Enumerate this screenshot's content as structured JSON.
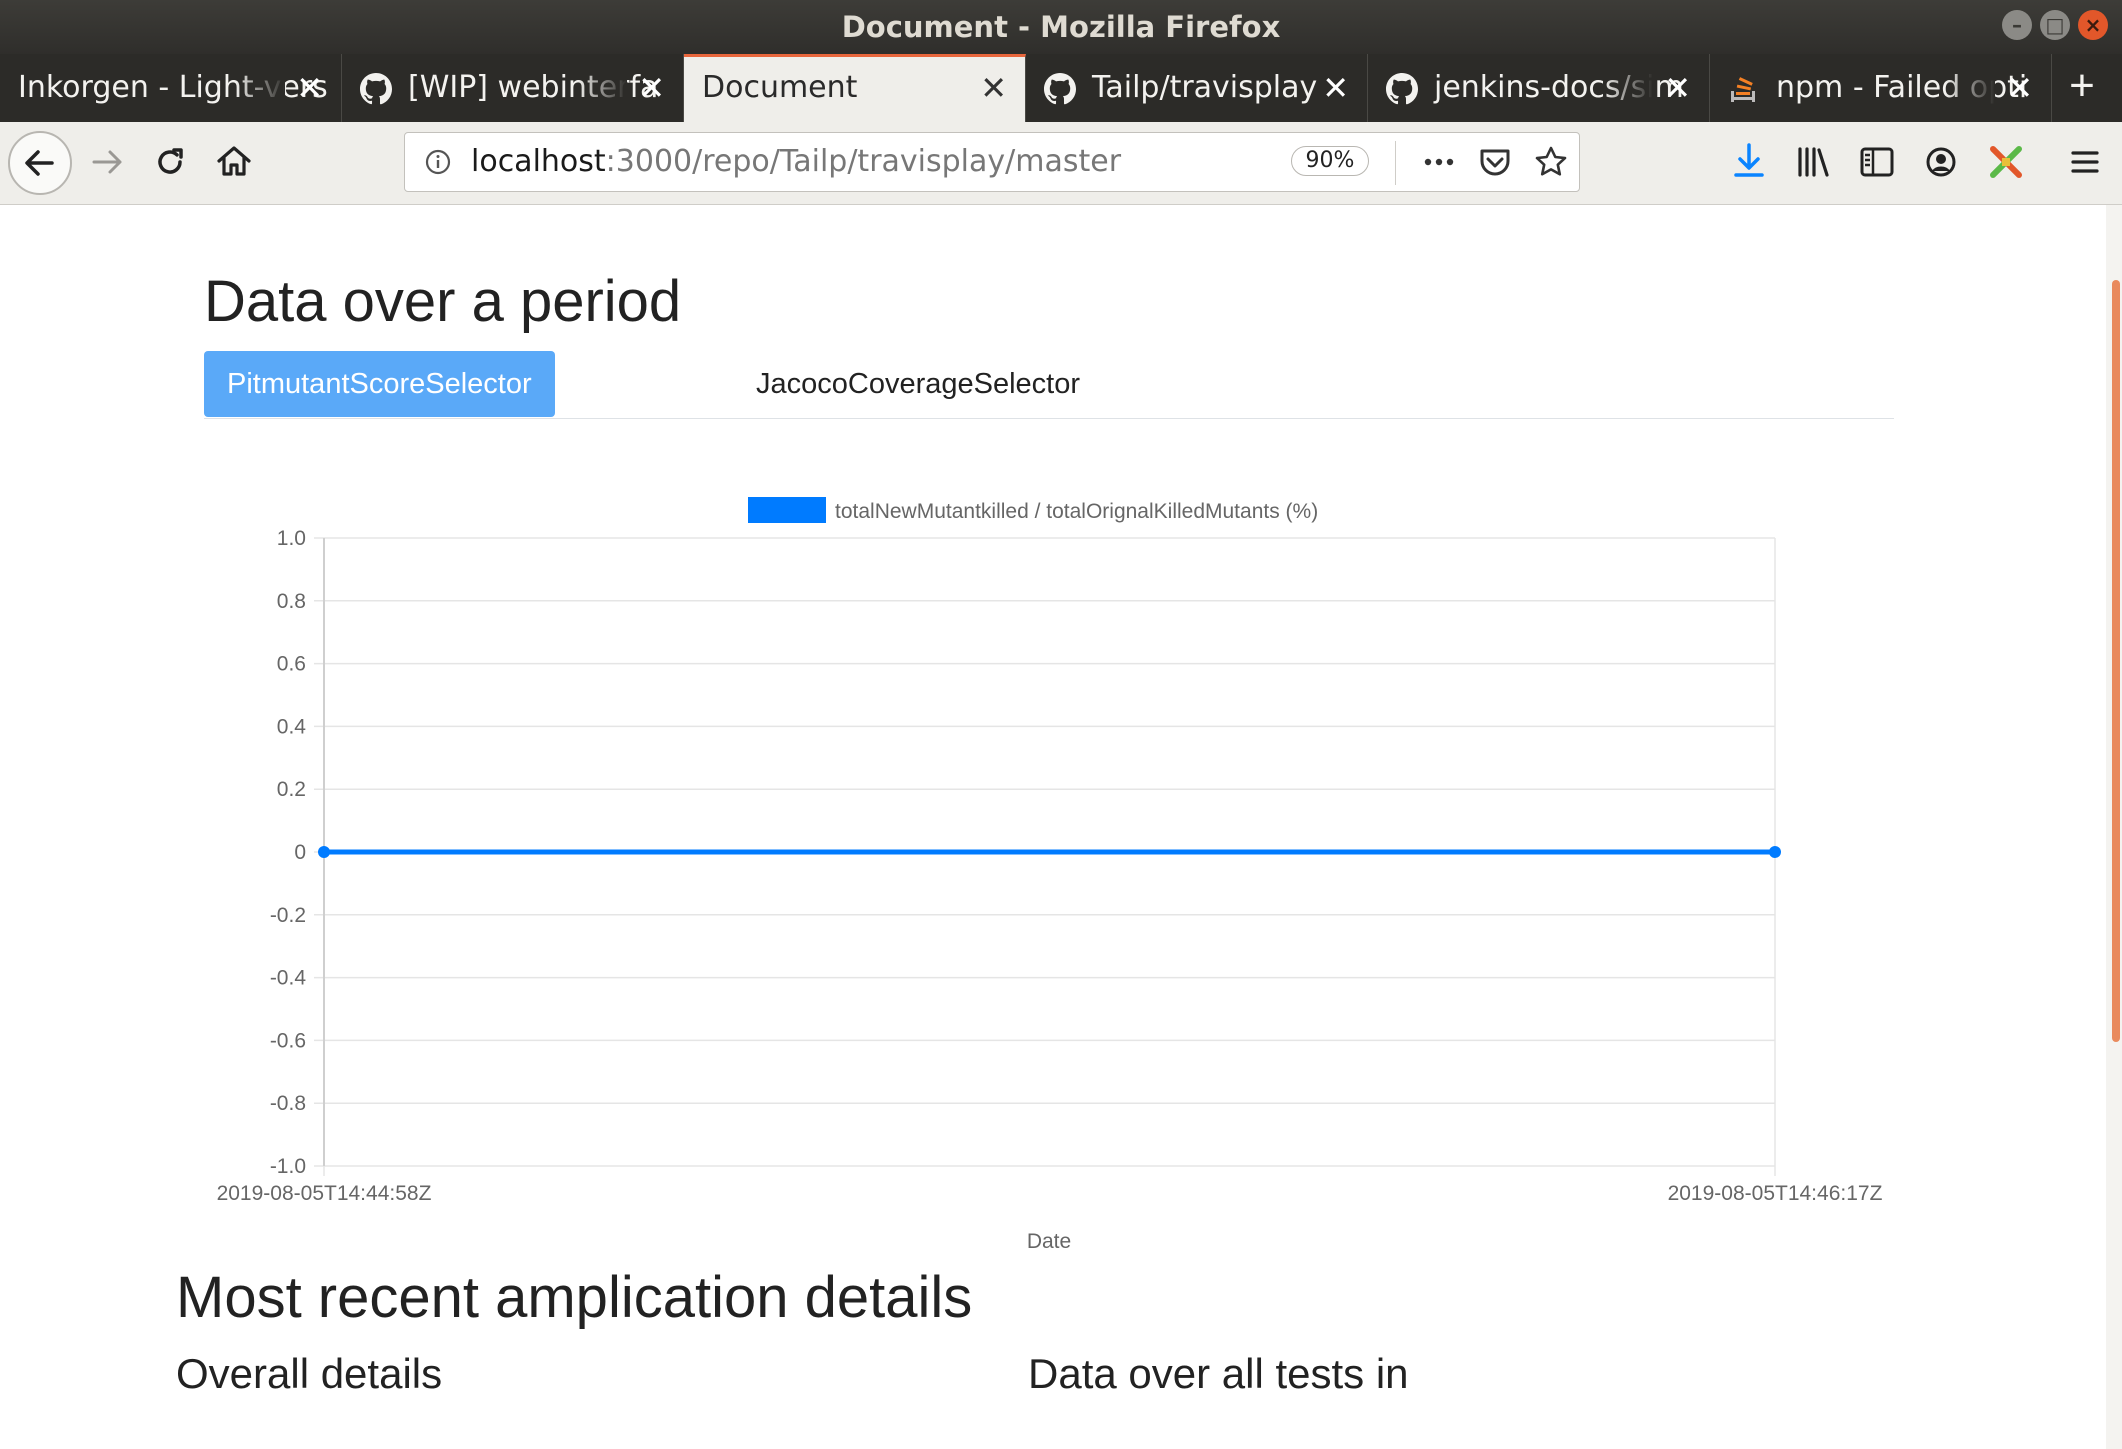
{
  "window": {
    "title": "Document - Mozilla Firefox"
  },
  "tabs": [
    {
      "label": "Inkorgen - Light-version",
      "icon": "none",
      "active": false
    },
    {
      "label": "[WIP] webinterface",
      "icon": "github-icon",
      "active": false
    },
    {
      "label": "Document",
      "icon": "none",
      "active": true
    },
    {
      "label": "Tailp/travisplay",
      "icon": "github-icon",
      "active": false
    },
    {
      "label": "jenkins-docs/simple",
      "icon": "github-icon",
      "active": false
    },
    {
      "label": "npm - Failed optional",
      "icon": "stackoverflow-icon",
      "active": false
    }
  ],
  "tabs_visible": [
    "Inkorgen - Light-vers",
    "[WIP] webinterfa",
    "Document",
    "Tailp/travisplay",
    "jenkins-docs/sim",
    "npm - Failed opti"
  ],
  "navbar": {
    "url_host": "localhost",
    "url_rest": ":3000/repo/Tailp/travisplay/master",
    "zoom": "90%"
  },
  "page": {
    "heading": "Data over a period",
    "selectors": [
      {
        "label": "PitmutantScoreSelector",
        "active": true
      },
      {
        "label": "JacocoCoverageSelector",
        "active": false
      }
    ],
    "section_heading": "Most recent amplication details",
    "overall_details": "Overall details",
    "data_over_tests": "Data over all tests in"
  },
  "colors": {
    "accent": "#007bff",
    "selector_active": "#5aa9f8",
    "tab_highlight": "#e8663c"
  },
  "chart_data": {
    "type": "line",
    "x": [
      "2019-08-05T14:44:58Z",
      "2019-08-05T14:46:17Z"
    ],
    "series": [
      {
        "name": "totalNewMutantkilled / totalOrignalKilledMutants (%)",
        "values": [
          0,
          0
        ],
        "color": "#007bff"
      }
    ],
    "ylim": [
      -1.0,
      1.0
    ],
    "yticks": [
      "1.0",
      "0.8",
      "0.6",
      "0.4",
      "0.2",
      "0",
      "-0.2",
      "-0.4",
      "-0.6",
      "-0.8",
      "-1.0"
    ],
    "xlabel": "Date",
    "ylabel": "",
    "grid": true,
    "legend": "top-center"
  }
}
